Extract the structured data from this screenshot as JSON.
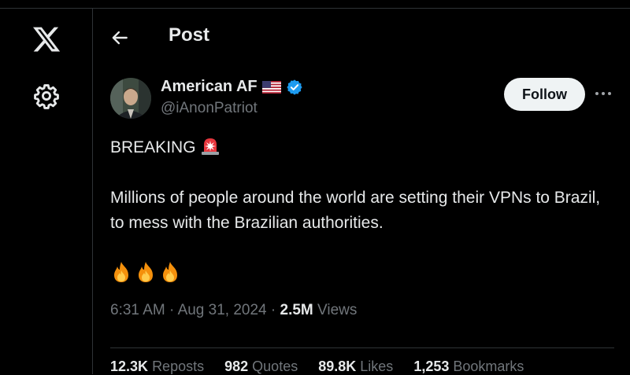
{
  "nav": {
    "logo_icon": "x-logo-icon",
    "settings_icon": "gear-icon"
  },
  "header": {
    "title": "Post",
    "back_icon": "arrow-left-icon"
  },
  "post": {
    "author": {
      "name": "American AF",
      "handle": "@iAnonPatriot",
      "flag_icon": "us-flag-icon",
      "verified_icon": "verified-badge-icon"
    },
    "follow_label": "Follow",
    "more_icon": "more-horizontal-icon",
    "text": {
      "line1": "BREAKING",
      "line2": "Millions of people around the world are setting their VPNs to Brazil, to mess with the Brazilian authorities."
    },
    "emoji": [
      "fire-icon",
      "fire-icon",
      "fire-icon"
    ],
    "meta": {
      "time": "6:31 AM",
      "sep1": "·",
      "date": "Aug 31, 2024",
      "sep2": "·",
      "views_count": "2.5M",
      "views_label": "Views"
    },
    "stats": [
      {
        "count": "12.3K",
        "label": "Reposts"
      },
      {
        "count": "982",
        "label": "Quotes"
      },
      {
        "count": "89.8K",
        "label": "Likes"
      },
      {
        "count": "1,253",
        "label": "Bookmarks"
      }
    ]
  },
  "colors": {
    "background": "#000000",
    "text": "#e7e9ea",
    "muted": "#71767b",
    "border": "#2f3336",
    "accent": "#1d9bf0",
    "button_bg": "#eff3f4"
  }
}
